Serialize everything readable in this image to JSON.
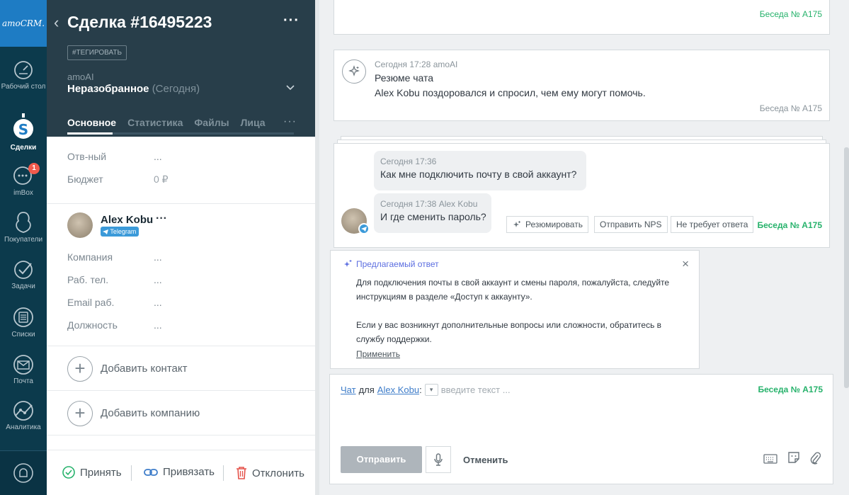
{
  "nav": {
    "logo": "amoCRM.",
    "items": [
      {
        "label": "Рабочий стол",
        "icon": "dashboard-icon"
      },
      {
        "label": "Сделки",
        "icon": "deals-icon"
      },
      {
        "label": "imBox",
        "icon": "chat-icon",
        "badge": "1"
      },
      {
        "label": "Покупатели",
        "icon": "customers-icon"
      },
      {
        "label": "Задачи",
        "icon": "tasks-icon"
      },
      {
        "label": "Списки",
        "icon": "lists-icon"
      },
      {
        "label": "Почта",
        "icon": "mail-icon"
      },
      {
        "label": "Аналитика",
        "icon": "analytics-icon"
      }
    ],
    "bell_icon": "bell-icon"
  },
  "lead": {
    "title": "Сделка #16495223",
    "tag_button": "#ТЕГИРОВАТЬ",
    "pipeline": "amoAI",
    "stage": "Неразобранное",
    "stage_date": "(Сегодня)",
    "tabs": [
      "Основное",
      "Статистика",
      "Файлы",
      "Лица"
    ],
    "tabs_more": "···",
    "progress": 0.2,
    "fields": [
      {
        "label": "Отв-ный",
        "value": "..."
      },
      {
        "label": "Бюджет",
        "value": "0 ₽"
      }
    ],
    "contact": {
      "name": "Alex Kobu",
      "more": "···",
      "channel": "Telegram",
      "fields": [
        {
          "label": "Компания",
          "value": "..."
        },
        {
          "label": "Раб. тел.",
          "value": "..."
        },
        {
          "label": "Email раб.",
          "value": "..."
        },
        {
          "label": "Должность",
          "value": "..."
        }
      ]
    },
    "add_contact": "Добавить контакт",
    "add_company": "Добавить компанию",
    "footer": {
      "accept": "Принять",
      "link": "Привязать",
      "decline": "Отклонить"
    }
  },
  "feed": {
    "top_note": {
      "conversation": "Беседа № A175"
    },
    "summary_note": {
      "meta": "Сегодня 17:28 amoAI",
      "title": "Резюме чата",
      "text": "Alex Kobu поздоровался и спросил, чем ему могут помочь.",
      "conversation": "Беседа № A175"
    },
    "messages": [
      {
        "meta": "Сегодня 17:36",
        "text": "Как мне подключить почту в свой аккаунт?"
      },
      {
        "meta": "Сегодня 17:38 Alex Kobu",
        "text": "И где сменить пароль?"
      }
    ],
    "chips": {
      "summarize": "Резюмировать",
      "nps": "Отправить NPS",
      "no_reply": "Не требует ответа"
    },
    "chat_conversation": "Беседа № A175",
    "suggestion": {
      "title": "Предлагаемый ответ",
      "close": "×",
      "para1": "Для подключения почты в свой аккаунт и смены пароля, пожалуйста, следуйте инструкциям в разделе «Доступ к аккаунту».",
      "para2": "Если у вас возникнут дополнительные вопросы или сложности, обратитесь в службу поддержки.",
      "apply": "Применить"
    },
    "composer": {
      "channel": "Чат",
      "for": "для",
      "recipient": "Alex Kobu",
      "colon": ":",
      "placeholder": "введите текст ...",
      "conversation": "Беседа № A175",
      "send": "Отправить",
      "cancel": "Отменить"
    }
  },
  "colors": {
    "nav_bg": "#0c3a4c",
    "logo_bg": "#1e7cc4",
    "header_bg": "#283e4a",
    "accent_green": "#26b26b",
    "link_blue": "#3d7cc9",
    "ai_purple": "#5c6ee0",
    "decline_red": "#e5534b"
  }
}
